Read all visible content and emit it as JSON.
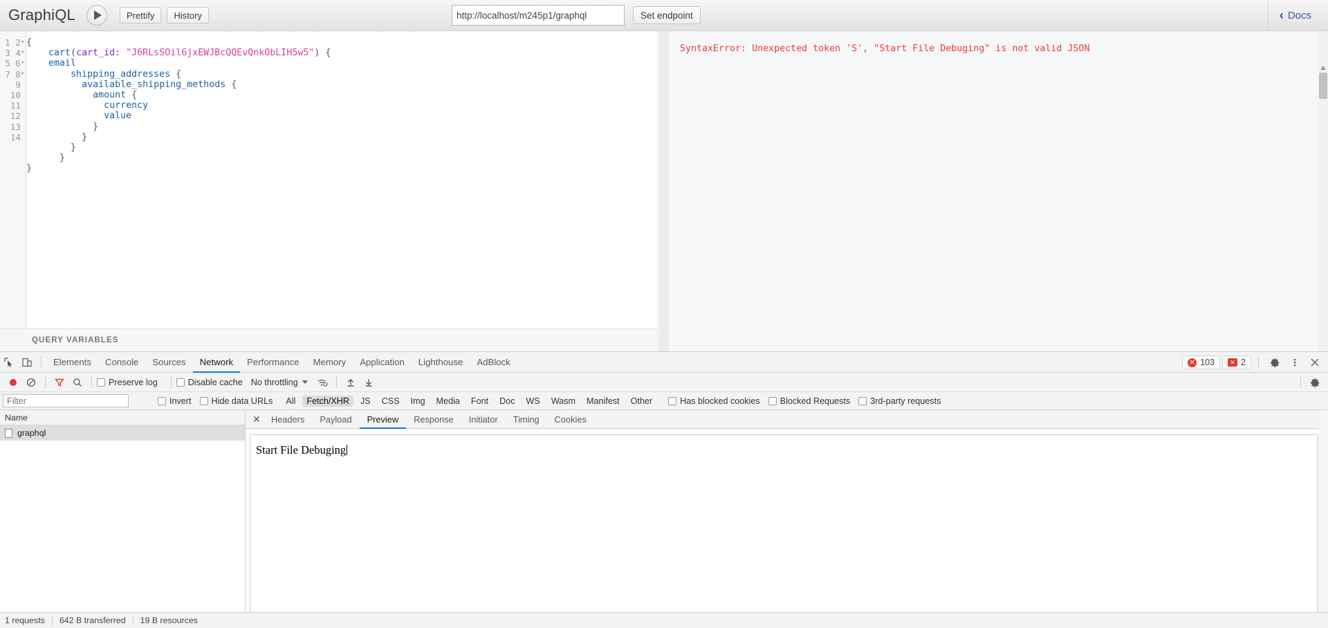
{
  "graphiql": {
    "logo": "GraphiQL",
    "execute_icon": "play-icon",
    "prettify_label": "Prettify",
    "history_label": "History",
    "endpoint_value": "http://localhost/m245p1/graphql",
    "endpoint_placeholder": "GraphQL Endpoint",
    "set_endpoint_label": "Set endpoint",
    "docs_label": "Docs",
    "docs_chevron": "‹",
    "query_variables_label": "QUERY VARIABLES",
    "line_numbers": [
      "1",
      "2",
      "3",
      "4",
      "5",
      "6",
      "7",
      "8",
      "9",
      "10",
      "11",
      "12",
      "13",
      "14"
    ],
    "fold_lines": [
      "1",
      "2",
      "4",
      "5"
    ],
    "query_lines": [
      "{",
      "    cart(cart_id: \"J6RLsSOil6jxEWJBcQQEvQnkObLIH5w5\") {",
      "    email",
      "        shipping_addresses {",
      "          available_shipping_methods {",
      "            amount {",
      "              currency",
      "              value",
      "            }",
      "          }",
      "        }",
      "      }",
      "}",
      ""
    ],
    "result_text": "SyntaxError: Unexpected token 'S', \"Start File Debuging\" is not valid JSON",
    "result_color": "#ef3a3a",
    "syntax_colors": {
      "field": "#1f61a0",
      "argument": "#8b2bb9",
      "string": "#d64292",
      "punctuation": "#555555"
    }
  },
  "devtools": {
    "inspect_icon": "inspect-element-icon",
    "device_icon": "device-toolbar-icon",
    "tabs": [
      {
        "label": "Elements",
        "active": false
      },
      {
        "label": "Console",
        "active": false
      },
      {
        "label": "Sources",
        "active": false
      },
      {
        "label": "Network",
        "active": true
      },
      {
        "label": "Performance",
        "active": false
      },
      {
        "label": "Memory",
        "active": false
      },
      {
        "label": "Application",
        "active": false
      },
      {
        "label": "Lighthouse",
        "active": false
      },
      {
        "label": "AdBlock",
        "active": false
      }
    ],
    "error_count": "103",
    "warning_count": "2",
    "settings_icon": "gear-icon",
    "more_icon": "kebab-menu-icon",
    "close_icon": "close-icon",
    "network_toolbar": {
      "record_icon": "record-icon",
      "clear_icon": "clear-icon",
      "filter_icon": "filter-icon",
      "search_icon": "search-icon",
      "preserve_log_label": "Preserve log",
      "disable_cache_label": "Disable cache",
      "throttling_label": "No throttling",
      "network_conditions_icon": "wifi-settings-icon",
      "import_har_icon": "upload-icon",
      "export_har_icon": "download-icon",
      "settings_icon": "gear-icon"
    },
    "filter_row": {
      "filter_placeholder": "Filter",
      "filter_value": "",
      "invert_label": "Invert",
      "hide_data_urls_label": "Hide data URLs",
      "types": [
        {
          "label": "All",
          "active": false
        },
        {
          "label": "Fetch/XHR",
          "active": true
        },
        {
          "label": "JS",
          "active": false
        },
        {
          "label": "CSS",
          "active": false
        },
        {
          "label": "Img",
          "active": false
        },
        {
          "label": "Media",
          "active": false
        },
        {
          "label": "Font",
          "active": false
        },
        {
          "label": "Doc",
          "active": false
        },
        {
          "label": "WS",
          "active": false
        },
        {
          "label": "Wasm",
          "active": false
        },
        {
          "label": "Manifest",
          "active": false
        },
        {
          "label": "Other",
          "active": false
        }
      ],
      "has_blocked_cookies_label": "Has blocked cookies",
      "blocked_requests_label": "Blocked Requests",
      "third_party_label": "3rd-party requests"
    },
    "request_list": {
      "column_header": "Name",
      "rows": [
        {
          "name": "graphql",
          "icon": "document-icon",
          "selected": true
        }
      ]
    },
    "detail": {
      "close_icon": "close-icon",
      "tabs": [
        {
          "label": "Headers",
          "active": false
        },
        {
          "label": "Payload",
          "active": false
        },
        {
          "label": "Preview",
          "active": true
        },
        {
          "label": "Response",
          "active": false
        },
        {
          "label": "Initiator",
          "active": false
        },
        {
          "label": "Timing",
          "active": false
        },
        {
          "label": "Cookies",
          "active": false
        }
      ],
      "preview_content": "Start File Debuging"
    },
    "status_bar": {
      "requests": "1 requests",
      "transferred": "642 B transferred",
      "resources": "19 B resources"
    }
  }
}
